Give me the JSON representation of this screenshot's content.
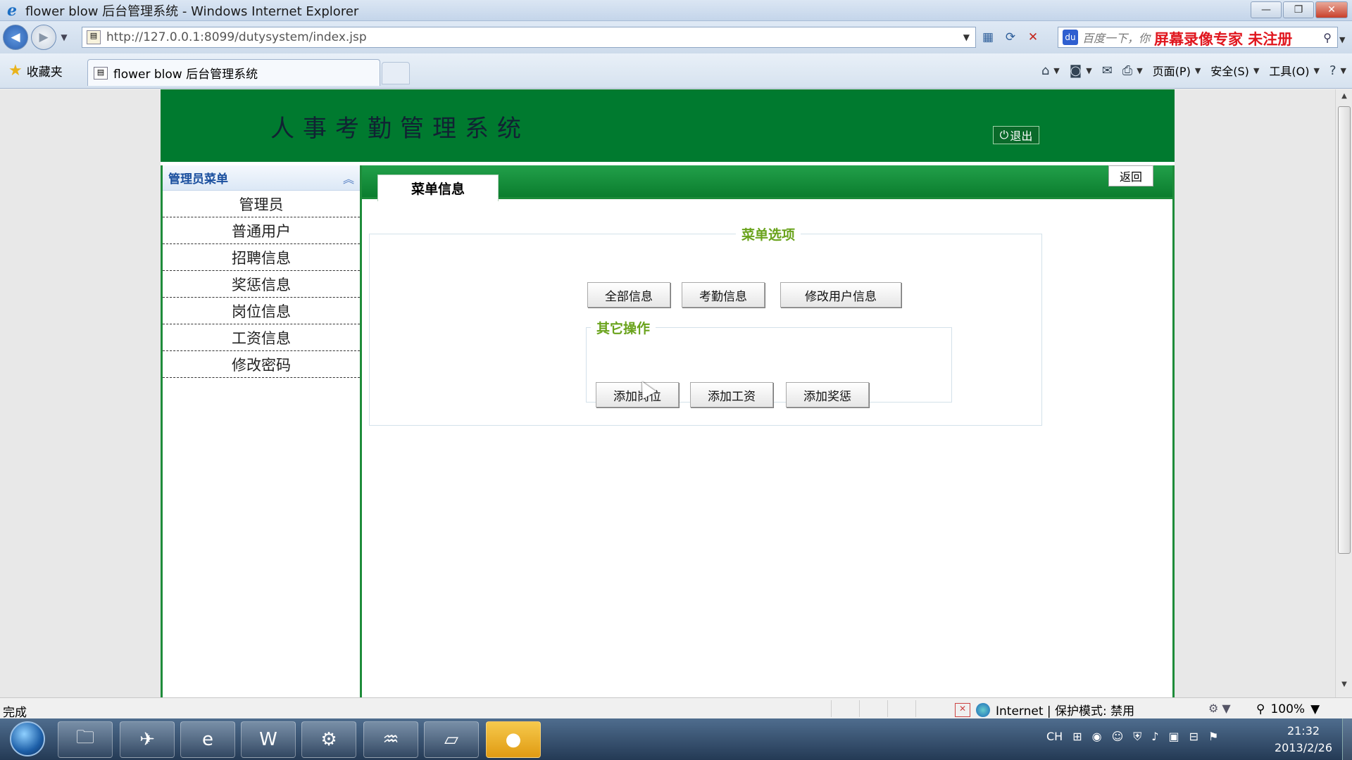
{
  "window": {
    "title": "flower blow 后台管理系统 - Windows Internet Explorer",
    "minimize": "—",
    "restore": "❐",
    "close": "✕"
  },
  "address_bar": {
    "url": "http://127.0.0.1:8099/dutysystem/index.jsp",
    "search_placeholder": "百度一下，你",
    "watermark": "屏幕录像专家  未注册"
  },
  "favorites_bar": {
    "favorites_label": "收藏夹",
    "tab_title": "flower blow 后台管理系统",
    "page_menu": "页面(P)",
    "safety_menu": "安全(S)",
    "tools_menu": "工具(O)"
  },
  "banner": {
    "system_title": "人事考勤管理系统",
    "logout_label": "退出"
  },
  "sidebar": {
    "header": "管理员菜单",
    "items": [
      {
        "label": "管理员"
      },
      {
        "label": "普通用户"
      },
      {
        "label": "招聘信息"
      },
      {
        "label": "奖惩信息"
      },
      {
        "label": "岗位信息"
      },
      {
        "label": "工资信息"
      },
      {
        "label": "修改密码"
      }
    ]
  },
  "main": {
    "tab_label": "菜单信息",
    "back_label": "返回",
    "menu_options": {
      "legend": "菜单选项",
      "buttons": [
        {
          "label": "全部信息"
        },
        {
          "label": "考勤信息"
        },
        {
          "label": "修改用户信息"
        }
      ]
    },
    "other_ops": {
      "legend": "其它操作",
      "buttons": [
        {
          "label": "添加岗位"
        },
        {
          "label": "添加工资"
        },
        {
          "label": "添加奖惩"
        }
      ]
    }
  },
  "status_bar": {
    "status_text": "完成",
    "zone_text": "Internet | 保护模式: 禁用",
    "zoom": "100%"
  },
  "taskbar": {
    "tray_lang": "CH",
    "time": "21:32",
    "date": "2013/2/26"
  },
  "colors": {
    "banner_green": "#007a2f",
    "accent_green": "#1e8c3a",
    "legend_green": "#6aa31c",
    "watermark_red": "#e0161e"
  }
}
